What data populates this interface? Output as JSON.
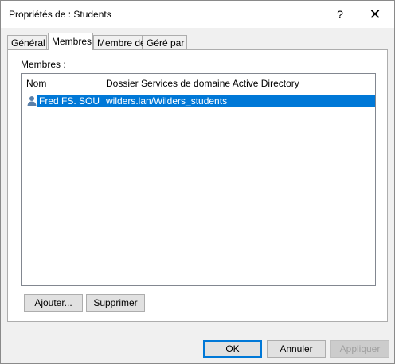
{
  "window": {
    "title": "Propriétés de : Students",
    "help_label": "?",
    "close_label": "✕"
  },
  "tabs": [
    {
      "label": "Général"
    },
    {
      "label": "Membres",
      "active": true
    },
    {
      "label": "Membre de"
    },
    {
      "label": "Géré par"
    }
  ],
  "members": {
    "label": "Membres :",
    "columns": [
      "Nom",
      "Dossier Services de domaine Active Directory"
    ],
    "rows": [
      {
        "name": "Fred FS. SOU...",
        "folder": "wilders.lan/Wilders_students",
        "icon": "user-icon",
        "selected": true
      }
    ],
    "add_label": "Ajouter...",
    "remove_label": "Supprimer"
  },
  "footer": {
    "ok_label": "OK",
    "cancel_label": "Annuler",
    "apply_label": "Appliquer"
  },
  "colors": {
    "selection": "#0078d7",
    "user_icon": "#5a7fa8"
  }
}
